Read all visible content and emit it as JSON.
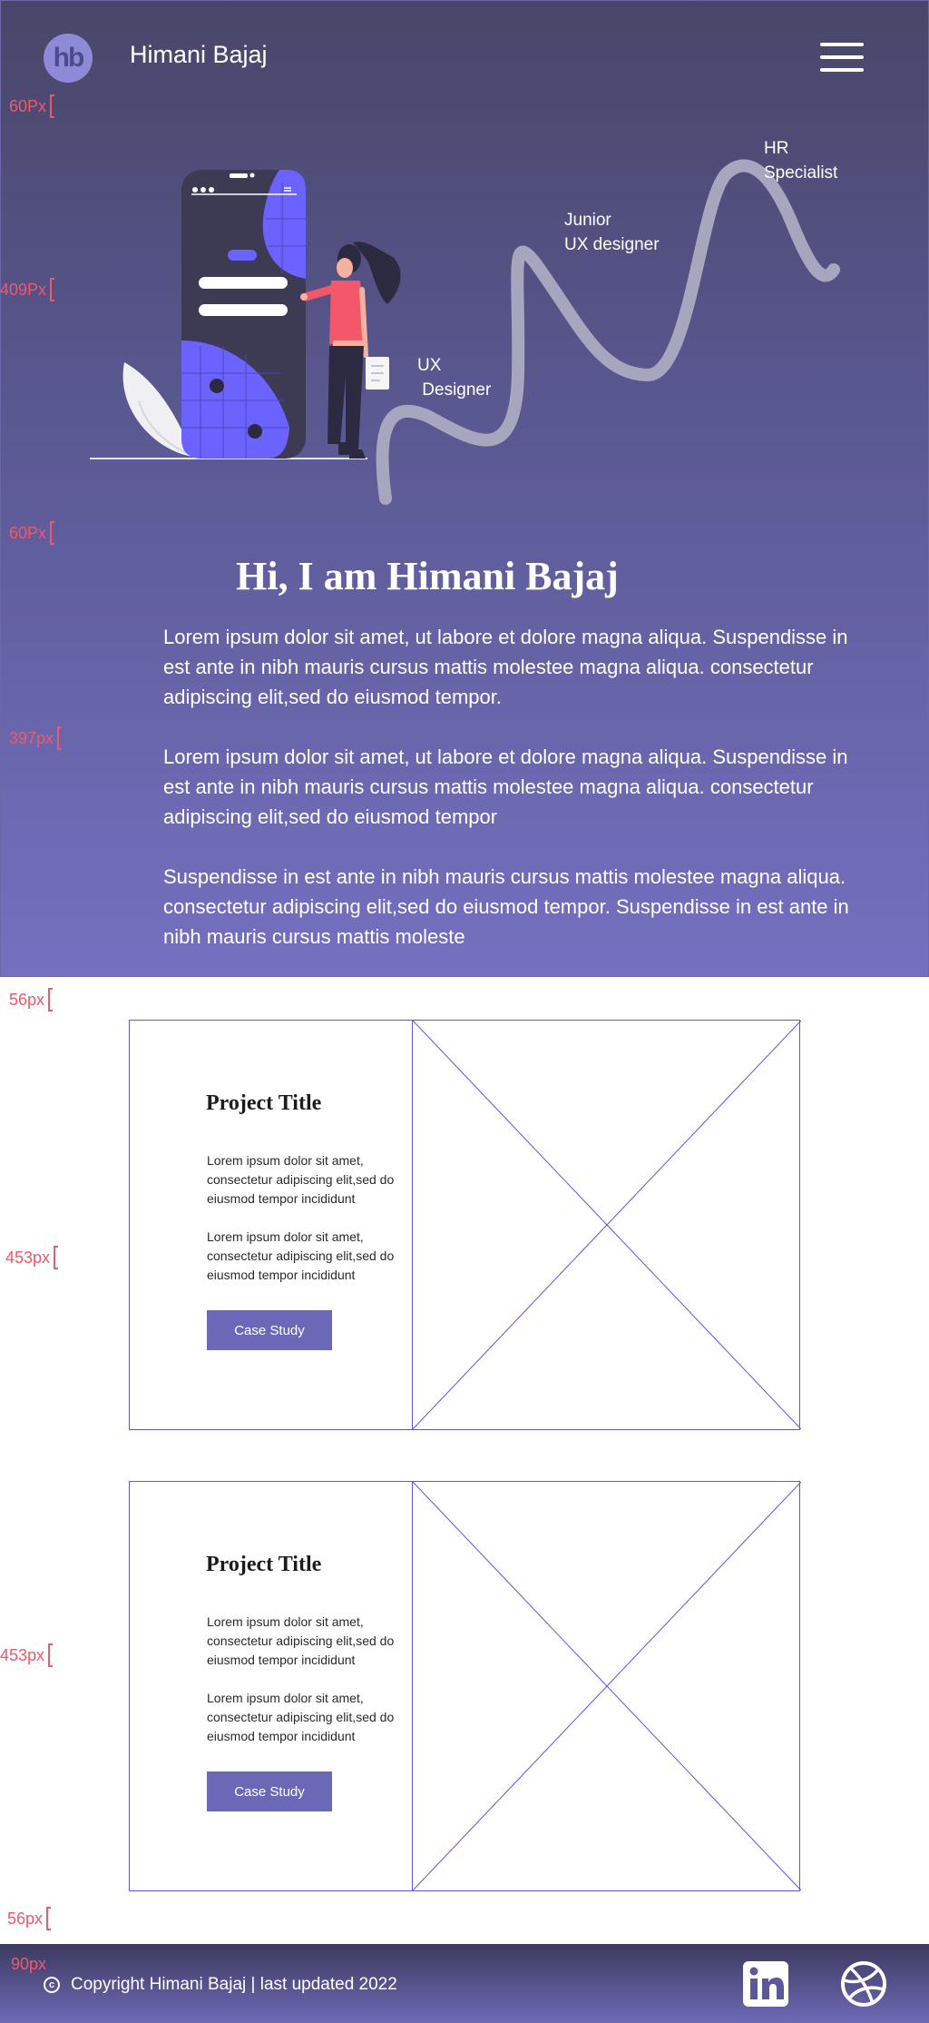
{
  "header": {
    "logo_text": "hb",
    "brand_name": "Himani Bajaj"
  },
  "spec_labels": [
    "60Px",
    "409Px",
    "60Px",
    "397px",
    "56px",
    "453px",
    "453px",
    "56px",
    "90px"
  ],
  "career_path": [
    "UX\n Designer",
    "Junior\nUX designer",
    "HR\nSpecialist"
  ],
  "hero": {
    "headline": "Hi, I am Himani Bajaj",
    "paragraphs": [
      "Lorem ipsum dolor sit amet, ut labore  et dolore magna aliqua. Suspendisse in est ante in nibh mauris cursus mattis molestee magna aliqua. consectetur adipiscing elit,sed do eiusmod tempor.",
      "Lorem ipsum dolor sit amet, ut labore  et dolore magna aliqua. Suspendisse in est ante in nibh mauris cursus mattis molestee magna aliqua. consectetur adipiscing elit,sed do eiusmod tempor",
      "Suspendisse in est ante in nibh mauris cursus mattis molestee magna aliqua. consectetur adipiscing elit,sed do eiusmod tempor. Suspendisse in est ante in nibh mauris cursus mattis moleste"
    ]
  },
  "projects": [
    {
      "title": "Project Title",
      "text1": "Lorem ipsum dolor sit amet, consectetur adipiscing elit,sed do eiusmod tempor incididunt",
      "text2": "Lorem ipsum dolor sit amet, consectetur adipiscing elit,sed do eiusmod tempor incididunt",
      "cta": "Case Study"
    },
    {
      "title": "Project Title",
      "text1": "Lorem ipsum dolor sit amet, consectetur adipiscing elit,sed do eiusmod tempor incididunt",
      "text2": "Lorem ipsum dolor sit amet, consectetur adipiscing elit,sed do eiusmod tempor incididunt",
      "cta": "Case Study"
    }
  ],
  "footer": {
    "copyright": "Copyright Himani Bajaj | last updated 2022"
  },
  "icons": {
    "menu": "hamburger-icon",
    "copyright": "copyright-icon",
    "linkedin": "linkedin-icon",
    "dribbble": "dribbble-icon"
  },
  "colors": {
    "accent": "#6c68b8",
    "spec": "#f2576a",
    "wireframe": "#5a58e0"
  }
}
